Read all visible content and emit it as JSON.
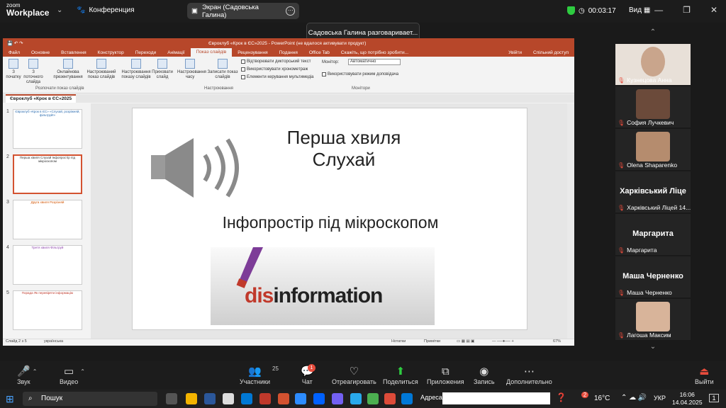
{
  "topbar": {
    "logo_line1": "zoom",
    "logo_line2": "Workplace",
    "conference": "Конференция",
    "screen_label": "Экран (Садовська Галина)",
    "timer": "00:03:17",
    "view": "Вид",
    "toast": "Садовська Галина разговаривает..."
  },
  "ppt": {
    "title": "Євроклуб «Крок в ЄС»2025 - PowerPoint (не вдалося активувати продукт)",
    "tabs": [
      "Файл",
      "Основне",
      "Вставлення",
      "Конструктор",
      "Переходи",
      "Анімації",
      "Показ слайдів",
      "Рецензування",
      "Подання",
      "Office Tab"
    ],
    "tell_me": "Скажіть, що потрібно зробити...",
    "login": "Увійти",
    "share": "Спільний доступ",
    "ribbon": {
      "b1": "З початку",
      "b2": "З поточного слайда",
      "b3": "Онлайнова презентування",
      "b4": "Настроюваний показ слайдів",
      "group1": "Розпочати показ слайдів",
      "b5": "Настроювання показу слайдів",
      "b6": "Приховати слайд",
      "b7": "Настроювання часу",
      "b8": "Записати показ слайдів",
      "chk1": "Відтворювати дикторський текст",
      "chk2": "Використовувати хронометраж",
      "chk3": "Елементи керування мультимедіа",
      "group2": "Настроювання",
      "monitor_label": "Монітор:",
      "monitor_value": "Автоматично",
      "chk4": "Використовувати режим доповідача",
      "group3": "Монітори"
    },
    "doc_tab": "Євроклуб «Крок в ЄС»2025",
    "slide": {
      "title_line1": "Перша хвиля",
      "title_line2": "Слухай",
      "subtitle": "Інфопростір під мікроскопом",
      "photo_word_red": "dis",
      "photo_word": "information"
    },
    "thumbs": [
      {
        "n": "1",
        "text": "Євроклуб «Крок в ЄС» «Слухай, розріжняй, фільтруй!»"
      },
      {
        "n": "2",
        "text": "Перша хвиля Слухай Інфопростір під мікроскопом"
      },
      {
        "n": "3",
        "text": "Друга хвиля Розрізняй"
      },
      {
        "n": "4",
        "text": "Третя хвиля Фільтруй"
      },
      {
        "n": "5",
        "text": "Порада Як перевіряти інформацію"
      }
    ],
    "status_left": "Слайд 2 з 5",
    "status_lang": "українська",
    "status_notes": "Нотатки",
    "status_comments": "Примітки",
    "zoom": "67%"
  },
  "participants": [
    {
      "name": "Кузнецова Анна",
      "type": "video",
      "face": "#c9a58c"
    },
    {
      "name": "София Лучкевич",
      "type": "video",
      "face": "#6b4a3a"
    },
    {
      "name": "Olena Shaparenko",
      "type": "video",
      "face": "#b58c6e"
    },
    {
      "name": "Харківський Ліцей 14...",
      "type": "name",
      "big": "Харківський Ліце"
    },
    {
      "name": "Маргарита",
      "type": "name",
      "big": "Маргарита"
    },
    {
      "name": "Маша Черненко",
      "type": "name",
      "big": "Маша Черненко"
    },
    {
      "name": "Лагоша Максим",
      "type": "video",
      "face": "#d8b49a"
    }
  ],
  "toolbar": {
    "audio": "Звук",
    "video": "Видео",
    "participants": "Участники",
    "participants_count": "25",
    "chat": "Чат",
    "chat_badge": "1",
    "react": "Отреагировать",
    "share": "Поделиться",
    "apps": "Приложения",
    "record": "Запись",
    "more": "Дополнительно",
    "leave": "Выйти"
  },
  "taskbar": {
    "search": "Пошук",
    "address": "Адреса",
    "temp": "16°C",
    "lang": "УКР",
    "time": "16:06",
    "date": "14.04.2025",
    "weather_badge": "2",
    "notif": "1"
  }
}
